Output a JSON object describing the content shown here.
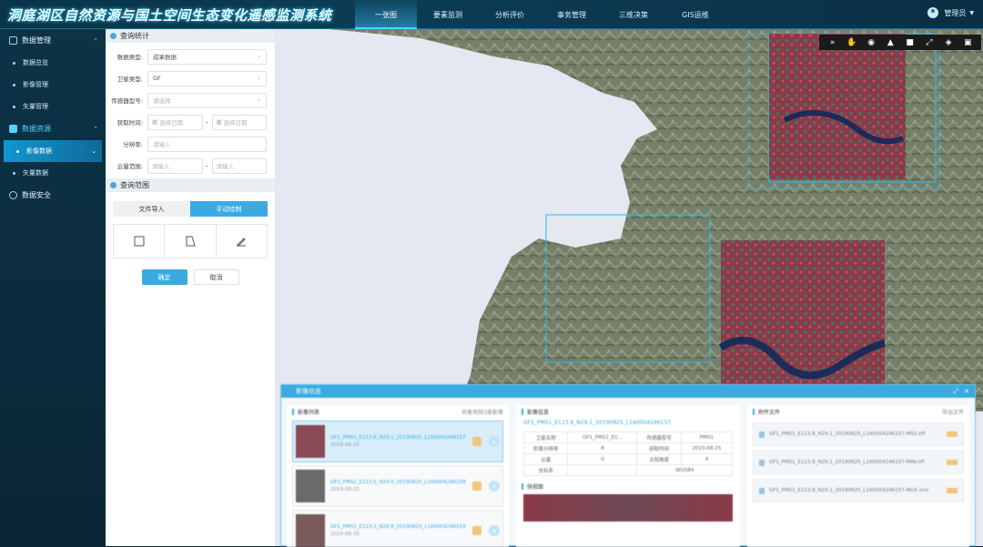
{
  "header": {
    "title": "洞庭湖区自然资源与国土空间生态变化遥感监测系统",
    "nav": [
      "一张图",
      "要素监测",
      "分析评价",
      "事务管理",
      "三维决策",
      "GIS运维"
    ],
    "active_nav": "一张图",
    "user": "管理员"
  },
  "sidebar": {
    "groups": [
      {
        "label": "数据管理",
        "items": [
          "数据总览",
          "影像管理",
          "矢量管理"
        ]
      },
      {
        "label": "数据资源",
        "items": [
          "影像数据",
          "矢量数据"
        ]
      },
      {
        "label": "数据安全",
        "items": []
      }
    ],
    "active_item": "影像数据"
  },
  "query": {
    "section_stats": "查询统计",
    "fields": {
      "data_type": {
        "label": "数据类型:",
        "value": "成果数据"
      },
      "satellite": {
        "label": "卫星类型:",
        "value": "GF"
      },
      "sensor": {
        "label": "传感器型号:",
        "placeholder": "请选择"
      },
      "time": {
        "label": "获取时间:",
        "placeholder": "选择日期"
      },
      "resolution": {
        "label": "分辨率:",
        "placeholder": "请输入"
      },
      "cloud": {
        "label": "云量范围:",
        "placeholder": "请输入"
      }
    },
    "section_range": "查询范围",
    "tabs": [
      "文件导入",
      "手动绘制"
    ],
    "active_tab": "手动绘制",
    "confirm": "确定",
    "cancel": "取消"
  },
  "results": {
    "title": "影像信息",
    "list_head": "影像列表",
    "list_right": "共查询到3景影像",
    "items": [
      {
        "name": "GF1_PMS1_E113.8_N29.1_20190825_L1A0004246157",
        "date": "2019-08-25"
      },
      {
        "name": "GF1_PMS2_E113.5_N29.0_20190825_L1A0004246158",
        "date": "2019-08-25"
      },
      {
        "name": "GF1_PMS1_E113.2_N28.8_20190825_L1A0004246159",
        "date": "2019-08-25"
      }
    ],
    "meta_head": "影像信息",
    "meta_name": "GF1_PMS1_E113.8_N29.1_20190825_L1A0004246157",
    "meta_rows": [
      [
        "卫星名称",
        "GF1_PMS1_E1...",
        "传感器型号",
        "PMS1"
      ],
      [
        "影像分辨率",
        "8",
        "获取时间",
        "2019-08-25"
      ],
      [
        "云量",
        "0",
        "太阳角度",
        "4"
      ],
      [
        "坐标系",
        "",
        "WGS84",
        ""
      ]
    ],
    "preview_head": "快视图",
    "files_head": "附件文件",
    "files_right": "导出文件",
    "files": [
      "GF1_PMS1_E113.8_N29.1_20190825_L1A0004246157-MSS.tiff",
      "GF1_PMS1_E113.8_N29.1_20190825_L1A0004246157-PAN.tiff",
      "GF1_PMS1_E113.8_N29.1_20190825_L1A0004246157-MUX.xml"
    ]
  },
  "map_tools": [
    "collapse-icon",
    "hand-icon",
    "palette-icon",
    "measure-icon",
    "toolbox-icon",
    "fullscreen-icon",
    "layers-icon",
    "save-icon"
  ]
}
